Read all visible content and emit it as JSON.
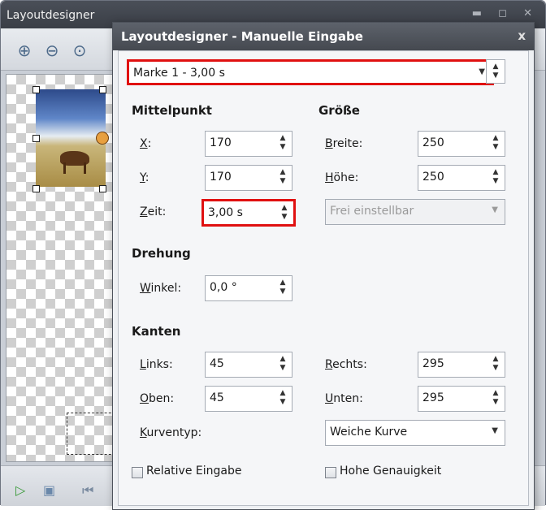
{
  "bg_window": {
    "title": "Layoutdesigner",
    "controls": "▬ ◻ ✕"
  },
  "dialog": {
    "title": "Layoutdesigner - Manuelle Eingabe",
    "close": "x",
    "marker_select": {
      "value": "Marke 1 - 3,00 s"
    },
    "mittelpunkt": {
      "heading": "Mittelpunkt",
      "x_label_u": "X",
      "x_label_rest": ":",
      "x_value": "170",
      "y_label_u": "Y",
      "y_label_rest": ":",
      "y_value": "170",
      "zeit_label_u": "Z",
      "zeit_label_rest": "eit:",
      "zeit_value": "3,00 s"
    },
    "groesse": {
      "heading": "Größe",
      "breite_label_u": "B",
      "breite_label_rest": "reite:",
      "breite_value": "250",
      "hoehe_label_u": "H",
      "hoehe_label_rest": "öhe:",
      "hoehe_value": "250",
      "mode_select": "Frei einstellbar"
    },
    "drehung": {
      "heading": "Drehung",
      "winkel_label_u": "W",
      "winkel_label_rest": "inkel:",
      "winkel_value": "0,0 °"
    },
    "kanten": {
      "heading": "Kanten",
      "links_label_u": "L",
      "links_label_rest": "inks:",
      "links_value": "45",
      "oben_label_u": "O",
      "oben_label_rest": "ben:",
      "oben_value": "45",
      "rechts_label_u": "R",
      "rechts_label_rest": "echts:",
      "rechts_value": "295",
      "unten_label_u": "U",
      "unten_label_rest": "nten:",
      "unten_value": "295",
      "kurventyp_label_u": "K",
      "kurventyp_label_rest": "urventyp:",
      "kurventyp_value": "Weiche Kurve"
    },
    "relative_eingabe": "Relative Eingabe",
    "hohe_genauigkeit": "Hohe Genauigkeit"
  },
  "icons": {
    "spin": "spin-up-down",
    "dropdown": "chevron-down",
    "zoom_in": "zoom-in",
    "zoom_out": "zoom-out",
    "zoom_fit": "zoom-fit",
    "play": "play",
    "rewind": "skip-back"
  },
  "colors": {
    "highlight": "#e01010",
    "titlebar": "#454950"
  }
}
